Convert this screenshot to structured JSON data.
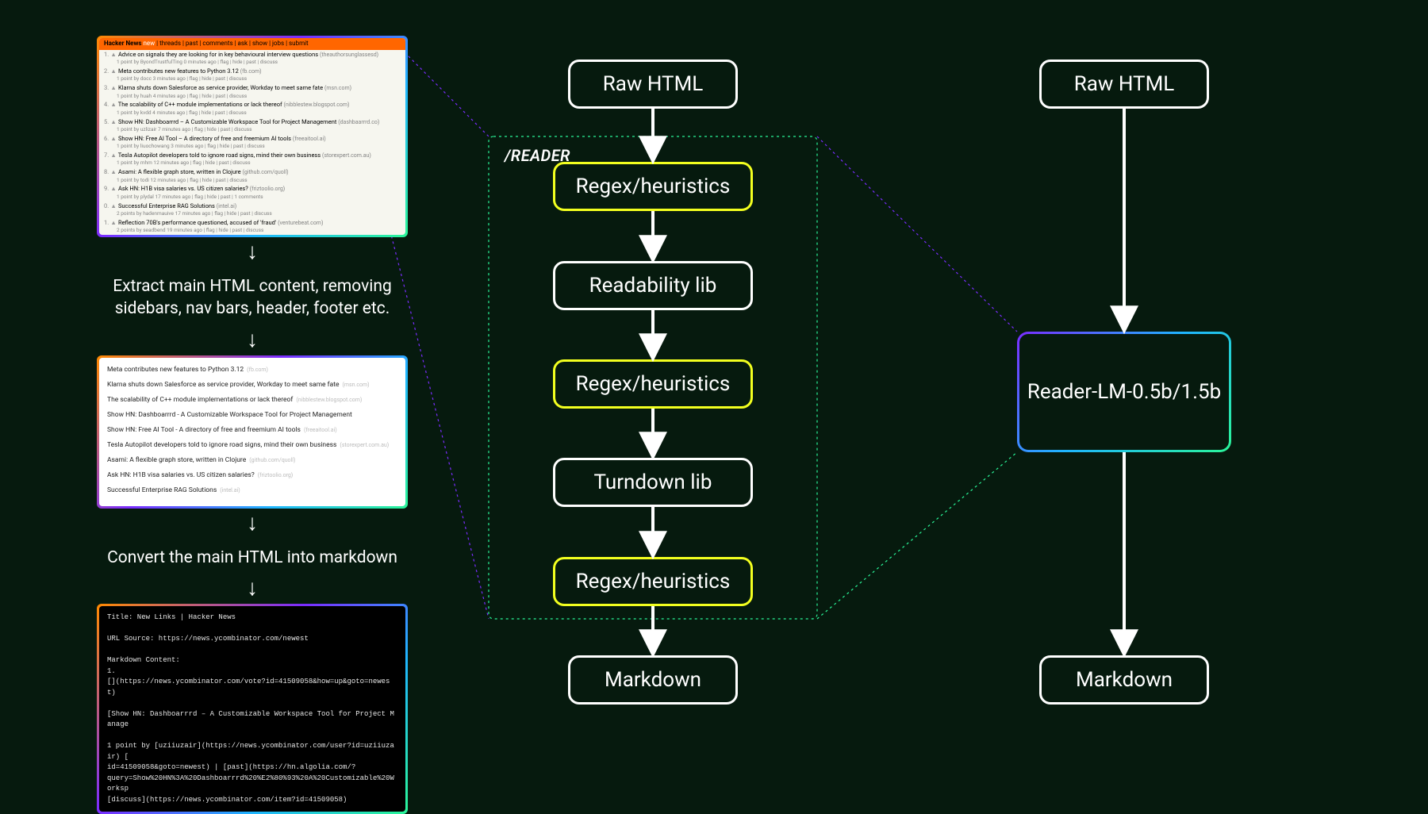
{
  "left": {
    "hn_header_brand": "Hacker News",
    "hn_header_new": "new",
    "hn_header_nav": " | threads | past | comments | ask | show | jobs | submit",
    "hn_items": [
      {
        "n": "1.",
        "t": "Advice on signals they are looking for in key behavioural interview questions",
        "s": "(theauthorsunglassesd)",
        "sub": "1 point by ByondTrustfulTing 0 minutes ago | flag | hide | past | discuss"
      },
      {
        "n": "2.",
        "t": "Meta contributes new features to Python 3.12",
        "s": "(fb.com)",
        "sub": "1 point by docc 3 minutes ago | flag | hide | past | discuss"
      },
      {
        "n": "3.",
        "t": "Klarna shuts down Salesforce as service provider, Workday to meet same fate",
        "s": "(msn.com)",
        "sub": "1 point by huah 4 minutes ago | flag | hide | past | discuss"
      },
      {
        "n": "4.",
        "t": "The scalability of C++ module implementations or lack thereof",
        "s": "(nibblestew.blogspot.com)",
        "sub": "1 point by kvdd 4 minutes ago | flag | hide | past | discuss"
      },
      {
        "n": "5.",
        "t": "Show HN: Dashboarrrd – A Customizable Workspace Tool for Project Management",
        "s": "(dashbaarrrd.co)",
        "sub": "1 point by uzlizair 7 minutes ago | flag | hide | past | discuss"
      },
      {
        "n": "6.",
        "t": "Show HN: Free AI Tool – A directory of free and freemium AI tools",
        "s": "(freeaitool.ai)",
        "sub": "1 point by liuochowang 3 minutes ago | flag | hide | past | discuss"
      },
      {
        "n": "7.",
        "t": "Tesla Autopilot developers told to ignore road signs, mind their own business",
        "s": "(storexpert.com.au)",
        "sub": "1 point by mhm 12 minutes ago | flag | hide | past | discuss"
      },
      {
        "n": "8.",
        "t": "Asami: A flexible graph store, written in Clojure",
        "s": "(github.com/quoll)",
        "sub": "1 point by todi 12 minutes ago | flag | hide | past | discuss"
      },
      {
        "n": "9.",
        "t": "Ask HN: H1B visa salaries vs. US citizen salaries?",
        "s": "(friztoolio.org)",
        "sub": "1 point by plydal 17 minutes ago | flag | hide | past | 1 comments"
      },
      {
        "n": "0.",
        "t": "Successful Enterprise RAG Solutions",
        "s": "(intel.ai)",
        "sub": "2 points by hadenmauive 17 minutes ago | flag | hide | past | discuss"
      },
      {
        "n": "1.",
        "t": "Reflection 70B's performance questioned, accused of 'fraud'",
        "s": "(venturebeat.com)",
        "sub": "2 points by seadbend 19 minutes ago | flag | hide | past | discuss"
      }
    ],
    "caption1_line1": "Extract main HTML content, removing",
    "caption1_line2": "sidebars, nav bars, header, footer etc.",
    "ext_items": [
      {
        "t": "Meta contributes new features to Python 3.12",
        "s": "(fb.com)"
      },
      {
        "t": "Klarna shuts down Salesforce as service provider, Workday to meet same fate",
        "s": "(msn.com)"
      },
      {
        "t": "The scalability of C++ module implementations or lack thereof",
        "s": "(nibblestew.blogspot.com)"
      },
      {
        "t": "Show HN: Dashboarrrd - A Customizable Workspace Tool for Project Management",
        "s": ""
      },
      {
        "t": "Show HN: Free AI Tool - A directory of free and freemium AI tools",
        "s": "(freeaitool.ai)"
      },
      {
        "t": "Tesla Autopilot developers told to ignore road signs, mind their own business",
        "s": "(storexpert.com.au)"
      },
      {
        "t": "Asami: A flexible graph store, written in Clojure",
        "s": "(github.com/quoll)"
      },
      {
        "t": "Ask HN: H1B visa salaries vs. US citizen salaries?",
        "s": "(friztoolio.org)"
      },
      {
        "t": "Successful Enterprise RAG Solutions",
        "s": "(intel.ai)"
      }
    ],
    "caption2": "Convert the main HTML into markdown",
    "term_text": "Title: New Links | Hacker News\n\nURL Source: https://news.ycombinator.com/newest\n\nMarkdown Content:\n1.\n[](https://news.ycombinator.com/vote?id=41509058&how=up&goto=newest)\n\n[Show HN: Dashboarrrd – A Customizable Workspace Tool for Project Manage\n\n1 point by [uziiuzair](https://news.ycombinator.com/user?id=uziiuzair) [\nid=41509058&goto=newest) | [past](https://hn.algolia.com/?\nquery=Show%20HN%3A%20Dashboarrrd%20%E2%80%93%20A%20Customizable%20Worksp\n[discuss](https://news.ycombinator.com/item?id=41509058)"
  },
  "center": {
    "reader_label": "/READER",
    "raw_html": "Raw HTML",
    "regex1": "Regex/heuristics",
    "readability": "Readability lib",
    "regex2": "Regex/heuristics",
    "turndown": "Turndown lib",
    "regex3": "Regex/heuristics",
    "markdown": "Markdown"
  },
  "right": {
    "raw_html": "Raw HTML",
    "model": "Reader-LM-0.5b/1.5b",
    "markdown": "Markdown"
  }
}
